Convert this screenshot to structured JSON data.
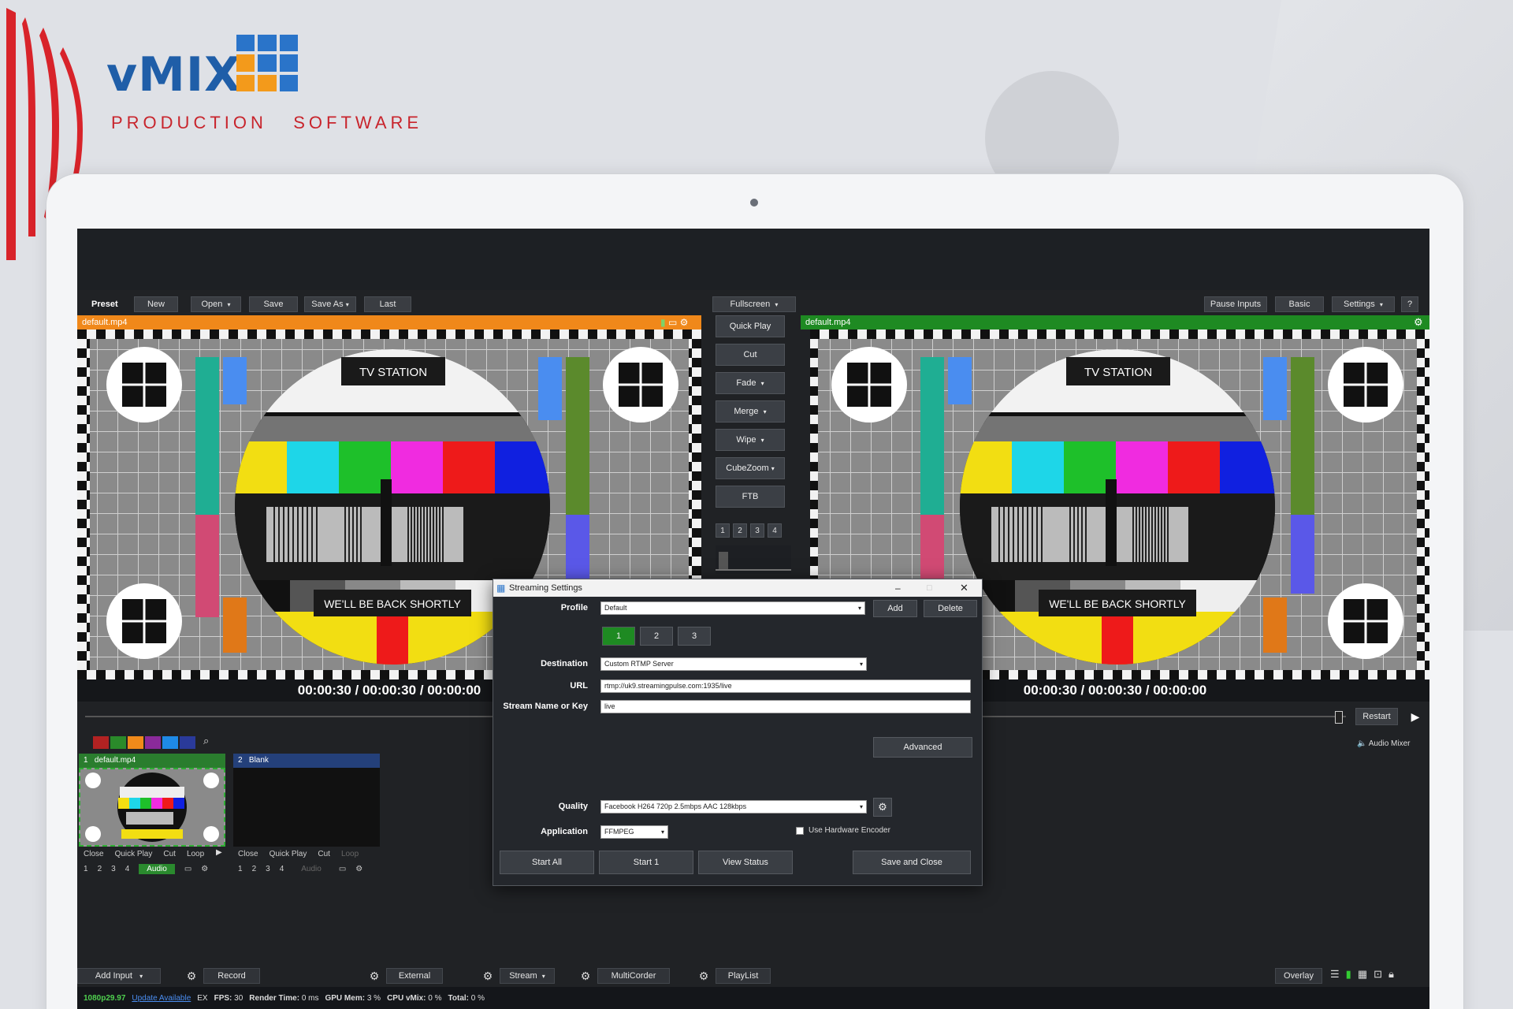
{
  "brand": {
    "name": "vMIX",
    "tagline": "PRODUCTION   SOFTWARE"
  },
  "toolbar": {
    "preset_label": "Preset",
    "buttons": [
      "New",
      "Open",
      "Save",
      "Save As",
      "Last"
    ],
    "fullscreen": "Fullscreen",
    "right_buttons": [
      "Pause Inputs",
      "Basic",
      "Settings",
      "?"
    ]
  },
  "preview": {
    "title": "default.mp4",
    "card_top": "TV STATION",
    "card_bottom": "WE'LL BE BACK SHORTLY",
    "time": "00:00:30  /  00:00:30  /  00:00:00",
    "accent": "#f0881a"
  },
  "output": {
    "title": "default.mp4",
    "card_top": "TV STATION",
    "card_bottom": "WE'LL BE BACK SHORTLY",
    "time": "00:00:30  /  00:00:30  /  00:00:00",
    "accent": "#1e8a22"
  },
  "transitions": {
    "items": [
      "Quick Play",
      "Cut",
      "Fade",
      "Merge",
      "Wipe",
      "CubeZoom",
      "FTB"
    ],
    "numbers": [
      "1",
      "2",
      "3",
      "4"
    ]
  },
  "playback": {
    "restart": "Restart",
    "audio_mixer": "Audio Mixer"
  },
  "color_filters": [
    "#b22222",
    "#2a8a2a",
    "#f08a1a",
    "#8a2a9a",
    "#1e8ae6",
    "#2a3a9a"
  ],
  "inputs": [
    {
      "number": "1",
      "name": "default.mp4",
      "controls": [
        "Close",
        "Quick Play",
        "Cut",
        "Loop"
      ],
      "nums": [
        "1",
        "2",
        "3",
        "4"
      ],
      "audio": "Audio"
    },
    {
      "number": "2",
      "name": "Blank",
      "controls": [
        "Close",
        "Quick Play",
        "Cut",
        "Loop"
      ],
      "nums": [
        "1",
        "2",
        "3",
        "4"
      ],
      "audio": "Audio"
    }
  ],
  "dialog": {
    "title": "Streaming Settings",
    "profile_label": "Profile",
    "profile_value": "Default",
    "add": "Add",
    "delete": "Delete",
    "tabs": [
      "1",
      "2",
      "3"
    ],
    "destination_label": "Destination",
    "destination_value": "Custom RTMP Server",
    "url_label": "URL",
    "url_value": "rtmp://uk9.streamingpulse.com:1935/live",
    "key_label": "Stream Name or Key",
    "key_value": "live",
    "advanced": "Advanced",
    "quality_label": "Quality",
    "quality_value": "Facebook H264 720p 2.5mbps AAC 128kbps",
    "application_label": "Application",
    "application_value": "FFMPEG",
    "hw_encoder_label": "Use Hardware Encoder",
    "buttons": [
      "Start All",
      "Start 1",
      "View Status",
      "Save and Close"
    ]
  },
  "bottom": {
    "add_input": "Add Input",
    "record": "Record",
    "external": "External",
    "stream": "Stream",
    "multicorder": "MultiCorder",
    "playlist": "PlayList",
    "overlay": "Overlay"
  },
  "status": {
    "format": "1080p29.97",
    "update": "Update Available",
    "ex": "EX",
    "fps_label": "FPS:",
    "fps": "30",
    "render_label": "Render Time:",
    "render": "0 ms",
    "gpu_label": "GPU Mem:",
    "gpu": "3 %",
    "cpu_label": "CPU vMix:",
    "cpu": "0 %",
    "total_label": "Total:",
    "total": "0 %"
  }
}
